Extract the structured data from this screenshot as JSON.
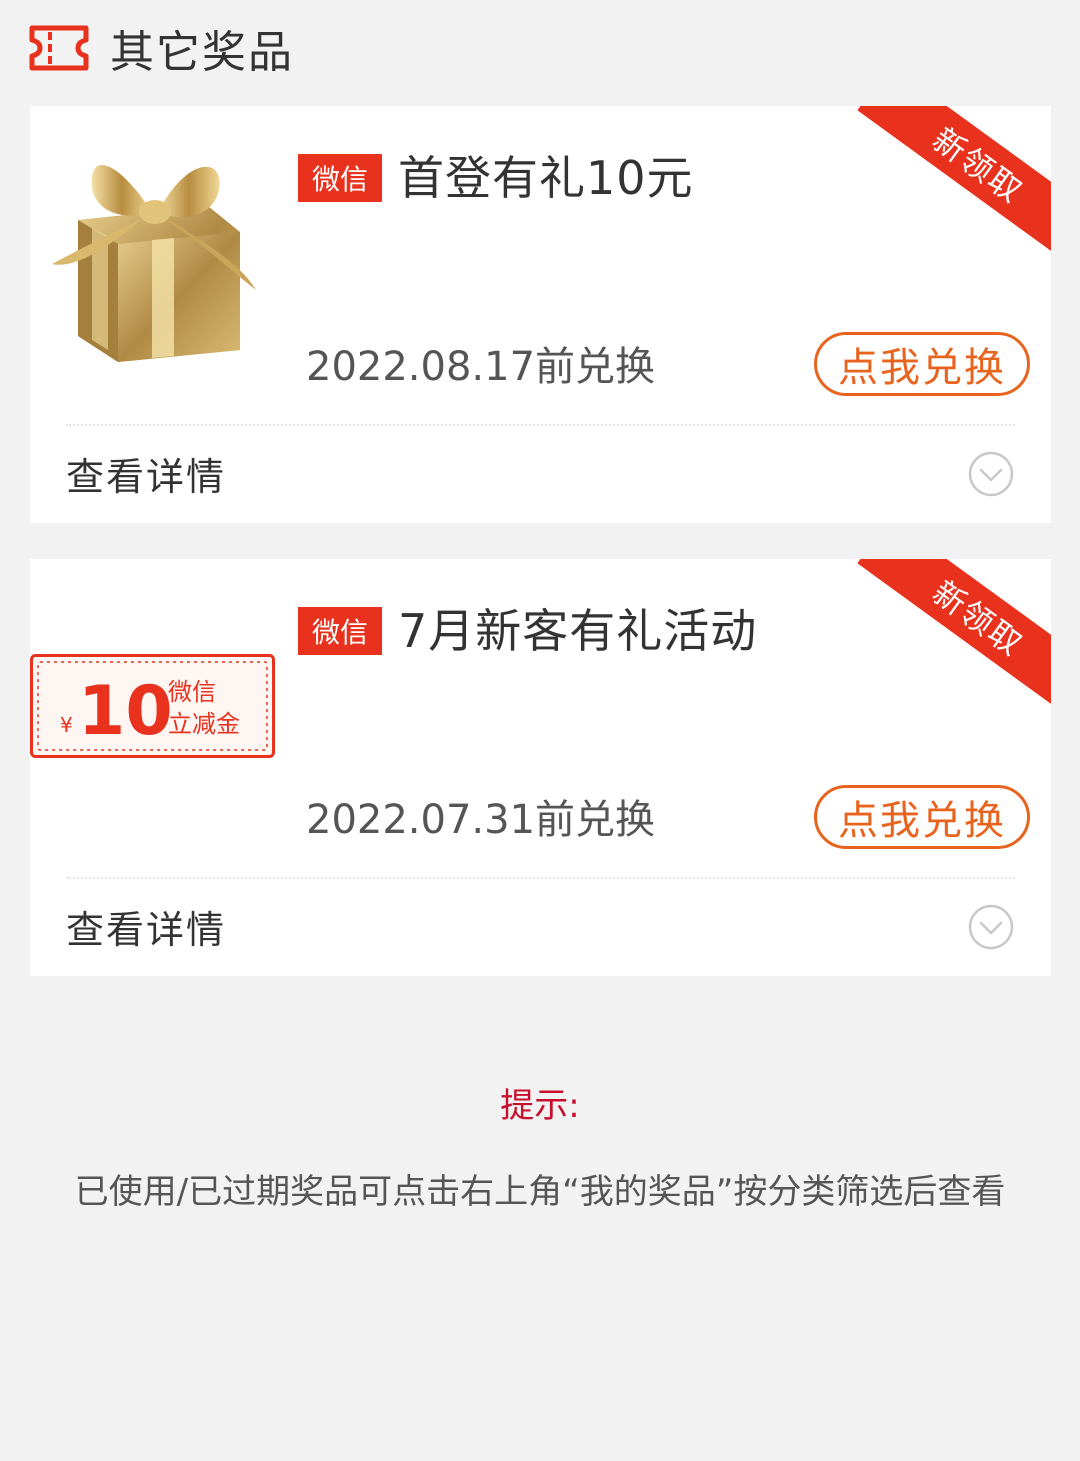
{
  "section": {
    "title": "其它奖品",
    "icon": "ticket-icon"
  },
  "colors": {
    "accent_red": "#e8321e",
    "button_orange": "#e8641e",
    "tip_red": "#c8102e",
    "background": "#f2f2f2"
  },
  "prizes": [
    {
      "tag": "微信",
      "title": "首登有礼10元",
      "ribbon": "新领取",
      "expire": "2022.08.17前兑换",
      "button": "点我兑换",
      "detail": "查看详情",
      "thumbnail": "gold-gift-box"
    },
    {
      "tag": "微信",
      "title": "7月新客有礼活动",
      "ribbon": "新领取",
      "expire": "2022.07.31前兑换",
      "button": "点我兑换",
      "detail": "查看详情",
      "thumbnail": "wechat-coupon",
      "coupon": {
        "currency": "¥",
        "amount": "10",
        "line1": "微信",
        "line2": "立减金"
      }
    }
  ],
  "tip": {
    "title": "提示:",
    "text": "已使用/已过期奖品可点击右上角“我的奖品”按分类筛选后查看"
  }
}
